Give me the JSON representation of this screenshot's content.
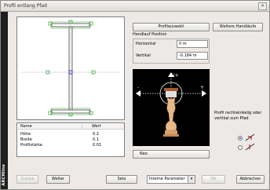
{
  "window": {
    "title": "Profil entlang Pfad",
    "close_glyph": "×",
    "side_label": "ARCHline"
  },
  "buttons": {
    "profile_select": "Profilauswahl",
    "more_rails": "Weitere Handläufe",
    "back": "Zurück",
    "next": "Weiter",
    "sets": "Sets",
    "ok": "Ok",
    "cancel": "Abbrechen"
  },
  "handrail_position": {
    "group_label": "Handlauf Position",
    "horizontal_label": "Horizontal",
    "horizontal_value": "0 m",
    "vertical_label": "Vertikal",
    "vertical_value": "-0.184 m"
  },
  "table": {
    "headers": [
      "Name",
      "Wert"
    ],
    "rows": [
      {
        "name": "Höhe",
        "value": "0.2"
      },
      {
        "name": "Breite",
        "value": "0.1"
      },
      {
        "name": "Profilstärke",
        "value": "0.01"
      }
    ]
  },
  "video": {
    "caption": "Neo",
    "up_sign": "i+",
    "left_sign": "-",
    "right_sign": "+"
  },
  "dropdown": {
    "selected": "Interne Parameter"
  },
  "orientation": {
    "label": "Profil rechtwinkelig oder vertikal zum Pfad",
    "option1_selected": true,
    "option2_selected": false
  },
  "colors": {
    "handle_green": "#2e9e2e",
    "center_blue": "#2020c0",
    "axis_gray": "#7f7f7f",
    "baluster_wood": "#e6b98a",
    "dialog_bg": "#ece9e6"
  }
}
